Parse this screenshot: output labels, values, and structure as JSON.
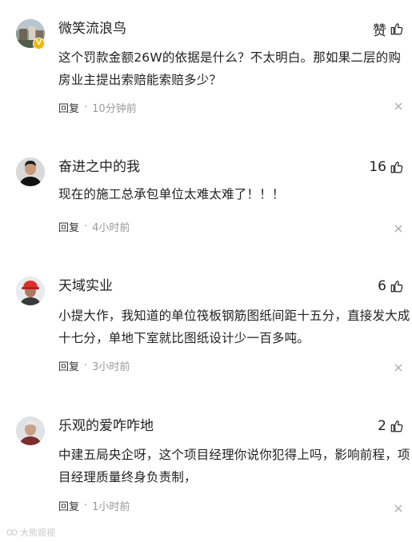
{
  "comments": [
    {
      "username": "微笑流浪鸟",
      "like_label": "赞",
      "text": "这个罚款金额26W的依据是什么？不太明白。那如果二层的购房业主提出索赔能索赔多少？",
      "reply_label": "回复",
      "separator": "·",
      "time": "10分钟前",
      "verified_badge": "V",
      "avatar_icon": "scenery-avatar-icon"
    },
    {
      "username": "奋进之中的我",
      "like_label": "16",
      "text": "现在的施工总承包单位太难太难了！！！",
      "reply_label": "回复",
      "separator": "·",
      "time": "4小时前",
      "avatar_icon": "man-portrait-avatar-icon"
    },
    {
      "username": "天域实业",
      "like_label": "6",
      "text": "小提大作，我知道的单位筏板钢筋图纸间距十五分，直接发大成十七分，单地下室就比图纸设计少一百多吨。",
      "reply_label": "回复",
      "separator": "·",
      "time": "3小时前",
      "avatar_icon": "red-helmet-worker-avatar-icon"
    },
    {
      "username": "乐观的爱咋咋地",
      "like_label": "2",
      "text": "中建五局央企呀，这个项目经理你说你犯得上吗，影响前程，项目经理质量终身负责制，",
      "reply_label": "回复",
      "separator": "·",
      "time": "1小时前",
      "avatar_icon": "elderly-man-avatar-icon"
    }
  ],
  "watermark": "大熊观视",
  "colors": {
    "text": "#222222",
    "meta": "#999999",
    "badge": "#f4b400"
  }
}
